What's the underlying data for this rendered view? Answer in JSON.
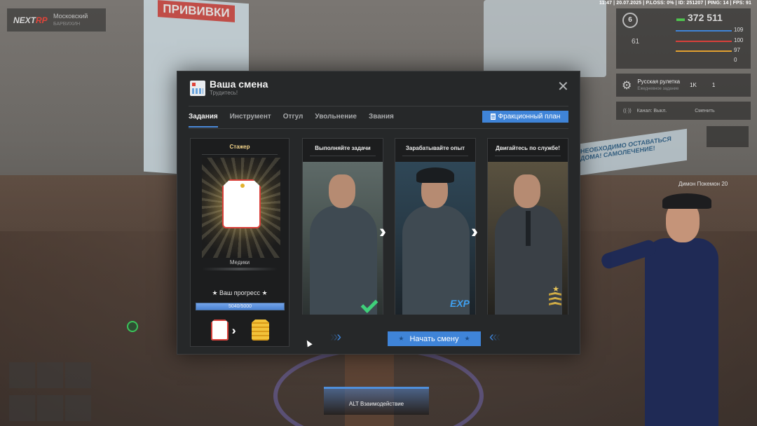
{
  "hud": {
    "status_bar": "11:47 | 20.07.2025 | P.LOSS: 0% | ID: 251207 | PING: 14 | FPS: 91",
    "logo_prefix": "NEXT",
    "logo_suffix": "RP",
    "server_name": "Московский",
    "server_sub": "БАРВИХИН",
    "level": "6",
    "money": "372 511",
    "stats": [
      "109",
      "100",
      "97",
      "0"
    ],
    "hunger": "61",
    "roulette_title": "Русская рулетка",
    "roulette_sub": "Ежедневное задание",
    "roulette_count1": "1K",
    "roulette_count2": "1",
    "channel_label": "Канал: Выкл.",
    "channel_hint": "Сменить",
    "player_tag": "Димон Покемон",
    "player_id": "20",
    "alt_hint": "ALT Взаимодействие"
  },
  "scene": {
    "poster_title": "ПРИВИВКИ",
    "banner_text": "НЕОБХОДИМО ОСТАВАТЬСЯ ДОМА! САМОЛЕЧЕНИЕ!"
  },
  "modal": {
    "title": "Ваша смена",
    "subtitle": "Трудитесь!",
    "tabs": [
      "Задания",
      "Инструмент",
      "Отгул",
      "Увольнение",
      "Звания"
    ],
    "active_tab": "Задания",
    "faction_plan_label": "Фракционный план",
    "rank": {
      "name": "Стажер",
      "department": "Медики",
      "progress_title": "Ваш прогресс",
      "progress_text": "5040/5000",
      "progress_fraction": 1.0
    },
    "steps": [
      {
        "title": "Выполняйте задачи",
        "badge": "check-icon"
      },
      {
        "title": "Зарабатывайте опыт",
        "badge": "EXP"
      },
      {
        "title": "Двигайтесь по службе!",
        "badge": "rank-chevron-icon"
      }
    ],
    "start_button_label": "Начать смену"
  }
}
